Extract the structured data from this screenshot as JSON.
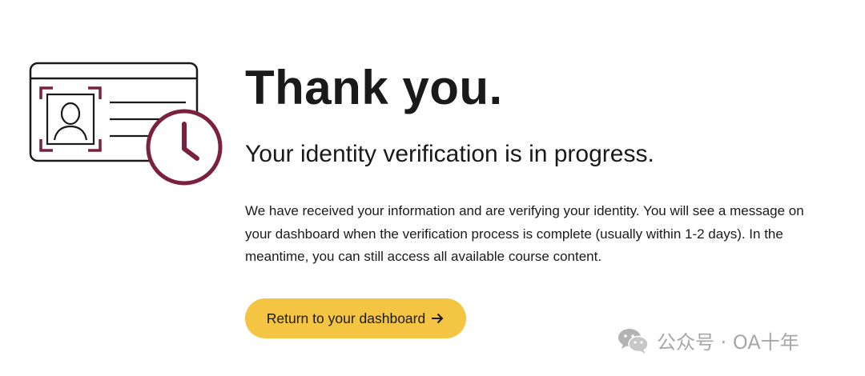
{
  "hero": {
    "title": "Thank you.",
    "subtitle": "Your identity verification is in progress.",
    "message": "We have received your information and are verifying your identity. You will see a message on your dashboard when the verification process is complete (usually within 1-2 days). In the meantime, you can still access all available course content."
  },
  "actions": {
    "return_label": "Return to your dashboard",
    "return_icon": "arrow-right-icon"
  },
  "illustration": {
    "icon": "id-card-verification-icon",
    "accent_color": "#7b2140",
    "stroke_color": "#1a1a1a"
  },
  "watermark": {
    "icon": "wechat-icon",
    "text": "公众号 · OA十年"
  },
  "colors": {
    "button_background": "#f4c543",
    "text": "#1a1a1a",
    "background": "#ffffff"
  }
}
